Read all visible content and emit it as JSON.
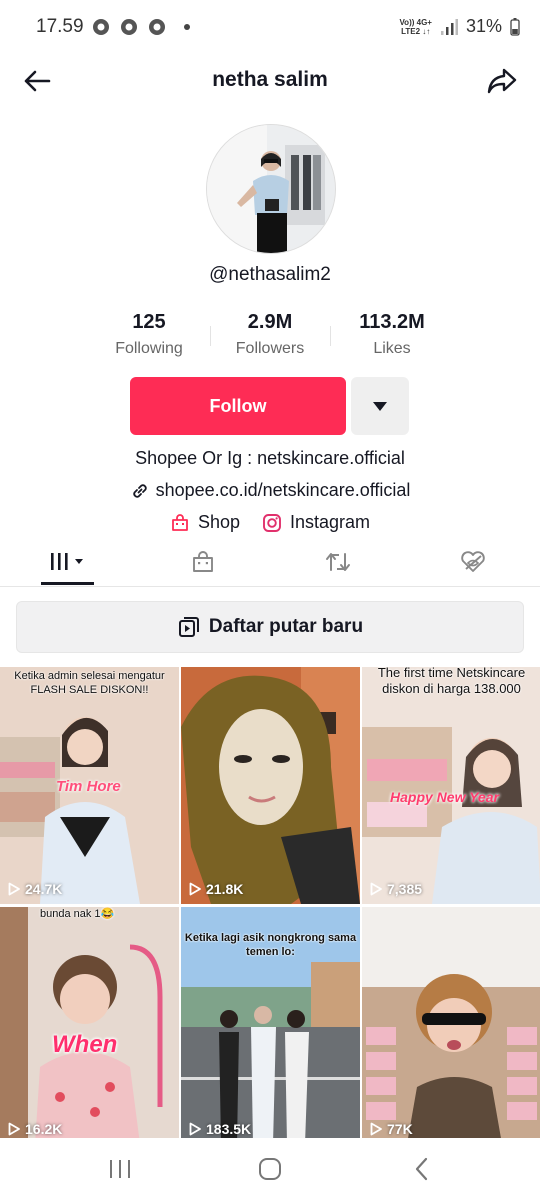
{
  "status_bar": {
    "time": "17.59",
    "network_top": "Vo)) 4G+",
    "network_bottom": "LTE2 ↓↑",
    "battery": "31%"
  },
  "header": {
    "title": "netha salim",
    "back_icon": "arrow-left-icon",
    "share_icon": "share-arrow-icon"
  },
  "profile": {
    "handle": "@nethasalim2",
    "stats": [
      {
        "value": "125",
        "label": "Following"
      },
      {
        "value": "2.9M",
        "label": "Followers"
      },
      {
        "value": "113.2M",
        "label": "Likes"
      }
    ],
    "follow_label": "Follow",
    "bio": "Shopee Or Ig :  netskincare.official",
    "link": "shopee.co.id/netskincare.official",
    "shop_label": "Shop",
    "instagram_label": "Instagram"
  },
  "tabs": [
    "videos-grid-icon",
    "shop-bag-icon",
    "repost-icon",
    "liked-hidden-icon"
  ],
  "playlist_label": "Daftar putar baru",
  "videos": [
    {
      "views": "24.7K",
      "caption": "Ketika admin selesai mengatur FLASH SALE DISKON!!",
      "sticker": "Tim Hore"
    },
    {
      "views": "21.8K",
      "caption": "",
      "sticker": ""
    },
    {
      "views": "7,385",
      "caption": "The first time Netskincare diskon di harga 138.000",
      "sticker": "Happy New Year"
    },
    {
      "views": "16.2K",
      "caption": "bunda nak 1😂",
      "sticker": "When"
    },
    {
      "views": "183.5K",
      "caption": "Ketika lagi asik nongkrong sama temen lo:",
      "sticker": ""
    },
    {
      "views": "77K",
      "caption": "",
      "sticker": ""
    }
  ],
  "colors": {
    "accent": "#fe2c55",
    "text": "#161823",
    "muted": "#666666"
  }
}
